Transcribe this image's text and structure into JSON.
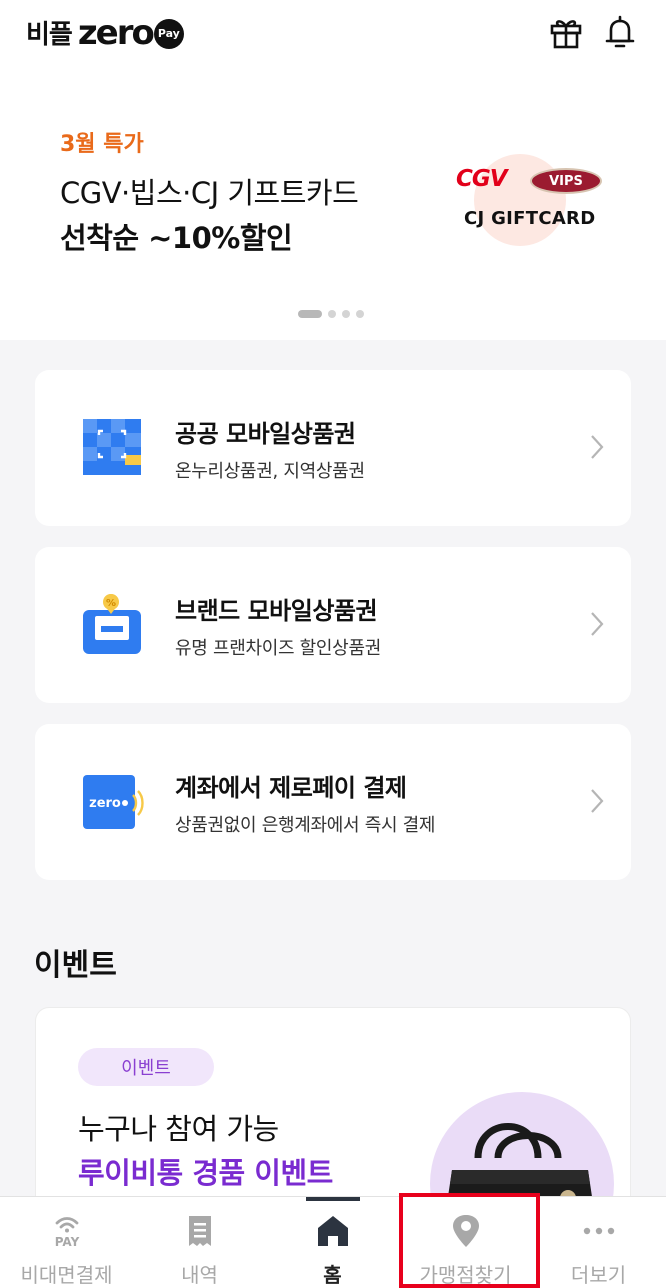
{
  "header": {
    "logo_kr": "비플",
    "logo_zero": "zero",
    "logo_pay": "Pay",
    "icons": [
      "gift-icon",
      "bell-icon"
    ]
  },
  "banner": {
    "eyebrow": "3월 특가",
    "line1": "CGV·빕스·CJ 기프트카드",
    "line2": "선착순 ~10%할인",
    "brand_cgv": "CGV",
    "brand_vips": "VIPS",
    "brand_cj": "CJ GIFTCARD",
    "page_index": 1,
    "page_count": 4,
    "accent_color": "#e96a1a"
  },
  "cards": [
    {
      "title": "공공 모바일상품권",
      "subtitle": "온누리상품권, 지역상품권",
      "icon": "public-voucher-icon"
    },
    {
      "title": "브랜드 모바일상품권",
      "subtitle": "유명 프랜차이즈 할인상품권",
      "icon": "brand-voucher-icon"
    },
    {
      "title": "계좌에서 제로페이 결제",
      "subtitle": "상품권없이 은행계좌에서 즉시 결제",
      "icon": "zero-pay-card-icon",
      "icon_text": "zero"
    }
  ],
  "events": {
    "section_title": "이벤트",
    "badge": "이벤트",
    "line1": "누구나 참여 가능",
    "line2": "루이비통 경품 이벤트",
    "accent_color": "#7a2bd0"
  },
  "nav": {
    "items": [
      {
        "label": "비대면결제",
        "icon": "wifi-pay-icon",
        "icon_text": "PAY"
      },
      {
        "label": "내역",
        "icon": "receipt-icon"
      },
      {
        "label": "홈",
        "icon": "home-icon"
      },
      {
        "label": "가맹점찾기",
        "icon": "location-pin-icon"
      },
      {
        "label": "더보기",
        "icon": "more-dots-icon"
      }
    ],
    "active_index": 2
  }
}
